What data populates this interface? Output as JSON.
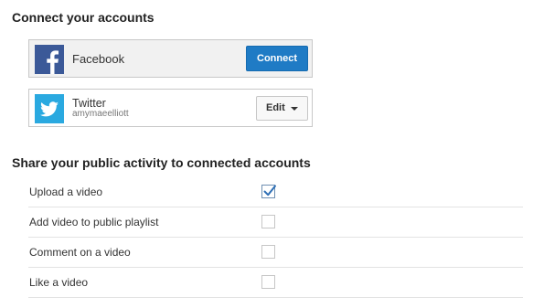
{
  "connect_section": {
    "title": "Connect your accounts",
    "accounts": [
      {
        "name": "Facebook",
        "icon": "facebook-logo-icon",
        "button_label": "Connect",
        "button_color": "#1f7bc5"
      },
      {
        "name": "Twitter",
        "username": "amymaeelliott",
        "icon": "twitter-logo-icon",
        "button_label": "Edit"
      }
    ]
  },
  "share_section": {
    "title": "Share your public activity to connected accounts",
    "items": [
      {
        "label": "Upload a video",
        "checked": true
      },
      {
        "label": "Add video to public playlist",
        "checked": false
      },
      {
        "label": "Comment on a video",
        "checked": false
      },
      {
        "label": "Like a video",
        "checked": false
      }
    ]
  },
  "colors": {
    "facebook_brand": "#3b5998",
    "twitter_brand": "#2aa9e0",
    "checkmark": "#2f6fb5"
  }
}
